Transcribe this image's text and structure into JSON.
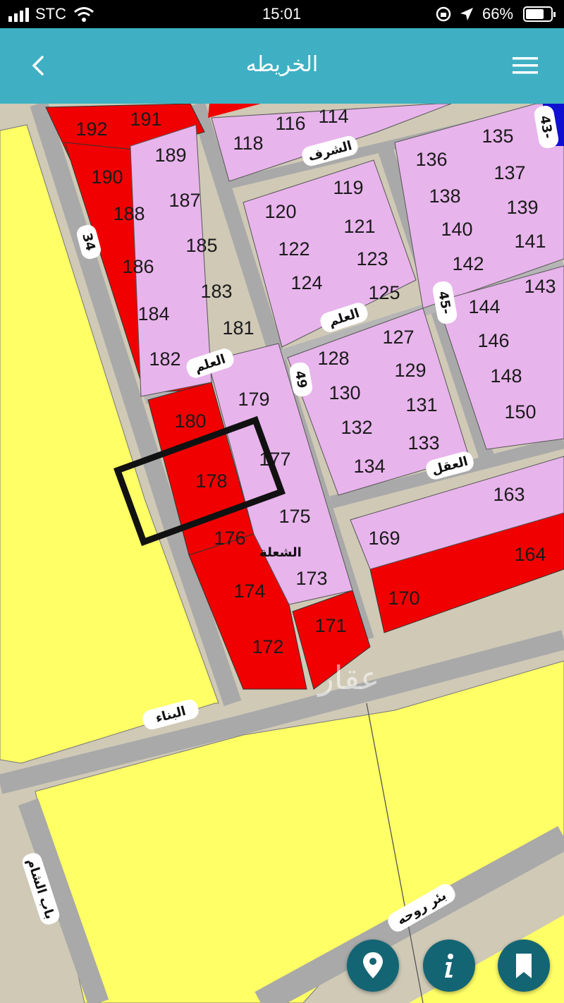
{
  "status_bar": {
    "carrier": "STC",
    "time": "15:01",
    "battery": "66%"
  },
  "header": {
    "title": "الخريطه",
    "back_icon": "chevron-left-icon",
    "menu_icon": "hamburger-menu-icon"
  },
  "colors": {
    "header": "#3fb0c3",
    "plot_available": "#e8b4ec",
    "plot_sold": "#f00000",
    "land_yellow": "#ffff66",
    "road": "#b5b5b5",
    "fab": "#146574"
  },
  "map": {
    "plots_sold": [
      "192",
      "191",
      "190",
      "188",
      "186",
      "184",
      "182",
      "180",
      "178",
      "176",
      "174",
      "172",
      "171",
      "170",
      "164"
    ],
    "plots_available": [
      "189",
      "187",
      "185",
      "183",
      "181",
      "179",
      "177",
      "175",
      "173",
      "169",
      "163",
      "118",
      "116",
      "114",
      "120",
      "119",
      "122",
      "121",
      "124",
      "123",
      "125",
      "128",
      "127",
      "130",
      "129",
      "132",
      "131",
      "134",
      "133",
      "136",
      "135",
      "138",
      "137",
      "140",
      "139",
      "142",
      "141",
      "144",
      "143",
      "146",
      "148",
      "150"
    ],
    "highlighted_plot": "178",
    "street_labels": {
      "s34": "34",
      "s49": "49",
      "s45": "45-",
      "s43": "43-",
      "alalam_left": "العلم",
      "alalam_mid": "العلم",
      "alsharaf": "الشرف",
      "alaql": "العقل",
      "alshoala": "الشعلة",
      "albinaa": "البناء",
      "bab_alsham": "باب الشام",
      "bir_rawha": "بئر روحه"
    },
    "watermark": "عقار"
  },
  "fabs": {
    "location": "location-pin-icon",
    "info": "info-icon",
    "bookmark": "bookmark-icon"
  }
}
